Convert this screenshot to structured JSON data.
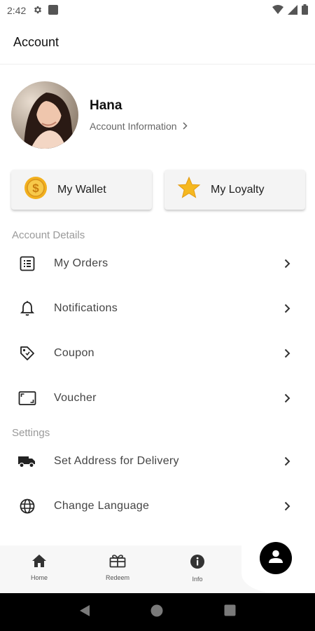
{
  "status_bar": {
    "time": "2:42"
  },
  "app_bar": {
    "title": "Account"
  },
  "profile": {
    "name": "Hana",
    "link_label": "Account Information"
  },
  "cards": [
    {
      "label": "My Wallet",
      "icon": "coin-icon"
    },
    {
      "label": "My Loyalty",
      "icon": "star-icon"
    }
  ],
  "sections": {
    "account_details": {
      "title": "Account Details",
      "items": [
        {
          "label": "My Orders",
          "icon": "orders-list-icon"
        },
        {
          "label": "Notifications",
          "icon": "bell-icon"
        },
        {
          "label": "Coupon",
          "icon": "tag-icon"
        },
        {
          "label": "Voucher",
          "icon": "voucher-icon"
        }
      ]
    },
    "settings": {
      "title": "Settings",
      "items": [
        {
          "label": "Set Address for Delivery",
          "icon": "truck-icon"
        },
        {
          "label": "Change Language",
          "icon": "globe-icon"
        }
      ]
    }
  },
  "bottom_nav": {
    "items": [
      {
        "label": "Home",
        "icon": "home-icon"
      },
      {
        "label": "Redeem",
        "icon": "gift-icon"
      },
      {
        "label": "Info",
        "icon": "info-icon"
      }
    ],
    "active": "account"
  },
  "colors": {
    "accent": "#000000",
    "section_header": "#9a9a9a",
    "coin": "#f2b01e",
    "star": "#f5b820"
  }
}
